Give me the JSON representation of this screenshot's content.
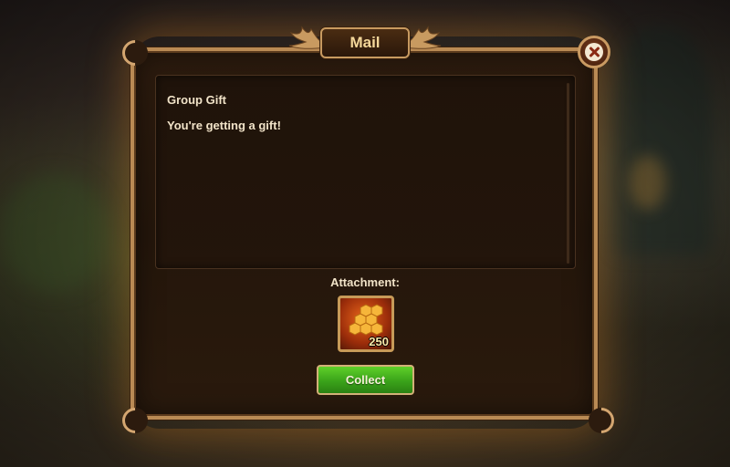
{
  "window": {
    "title": "Mail"
  },
  "message": {
    "subject": "Group Gift",
    "body": "You're getting a gift!"
  },
  "attachment": {
    "label": "Attachment:",
    "item": {
      "icon": "honeycomb-icon",
      "count": "250"
    }
  },
  "actions": {
    "collect_label": "Collect",
    "close_icon": "close-icon"
  },
  "colors": {
    "accent_gold": "#c89a60",
    "button_green": "#3aa31a",
    "panel_brown": "#24160b"
  }
}
